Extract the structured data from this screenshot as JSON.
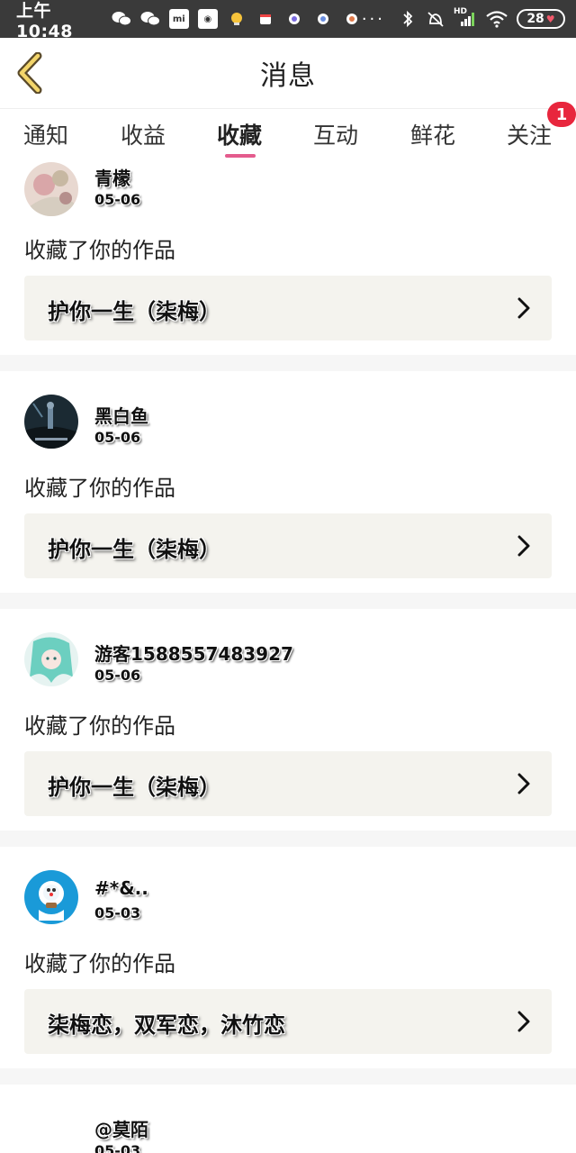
{
  "status_bar": {
    "time": "上午10:48",
    "battery": "28",
    "more": "···",
    "hd_label": "HD"
  },
  "header": {
    "title": "消息"
  },
  "tabs": [
    {
      "label": "通知"
    },
    {
      "label": "收益"
    },
    {
      "label": "收藏",
      "active": true
    },
    {
      "label": "互动"
    },
    {
      "label": "鲜花"
    },
    {
      "label": "关注",
      "badge": "1"
    }
  ],
  "messages": [
    {
      "name": "青檬",
      "date": "05-06",
      "action": "收藏了你的作品",
      "work": "护你一生（柒梅）"
    },
    {
      "name": "黑白鱼",
      "date": "05-06",
      "action": "收藏了你的作品",
      "work": "护你一生（柒梅）"
    },
    {
      "name": "游客1588557483927",
      "date": "05-06",
      "action": "收藏了你的作品",
      "work": "护你一生（柒梅）"
    },
    {
      "name": "#*&..",
      "date": "05-03",
      "action": "收藏了你的作品",
      "work": "柒梅恋，双军恋，沐竹恋"
    },
    {
      "name": "@莫陌",
      "date": "05-03",
      "action": "",
      "work": ""
    }
  ],
  "colors": {
    "accent": "#e45b8d",
    "badge": "#e8263d",
    "work_box": "#f4f3ee",
    "status_bar": "#3a3a3a"
  }
}
